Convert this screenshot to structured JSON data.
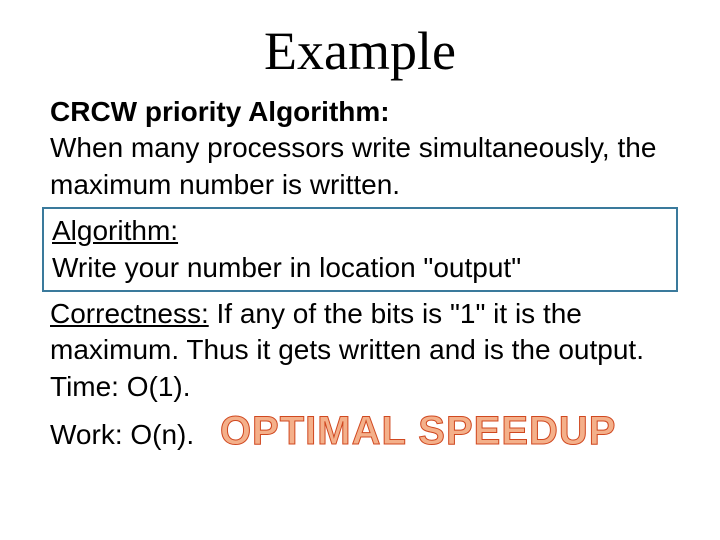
{
  "title": "Example",
  "heading": "CRCW priority Algorithm:",
  "line1": "When many processors write simultaneously, the maximum number is written.",
  "boxed_heading": "Algorithm:",
  "boxed_text": "Write your number in location \"output\"",
  "correctness_label": "Correctness:",
  "correctness_text": " If any of the bits is \"1\" it is the maximum. Thus it gets written and is the output.",
  "time_line": "Time: O(1).",
  "work_line": "Work: O(n).",
  "optimal": "OPTIMAL SPEEDUP"
}
